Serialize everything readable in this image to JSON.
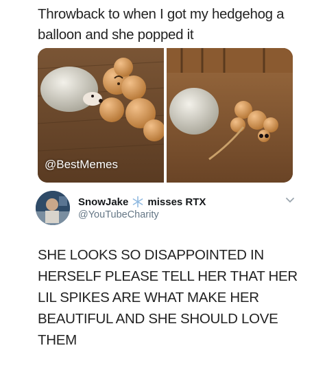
{
  "caption": "Throwback to when I got my hedgehog a balloon and she popped it",
  "media": {
    "watermark": "@BestMemes"
  },
  "reply": {
    "display_name": "SnowJake",
    "name_suffix": "misses RTX",
    "handle": "@YouTubeCharity",
    "text": "SHE LOOKS SO DISAPPOINTED IN HERSELF PLEASE TELL HER THAT HER LIL SPIKES ARE WHAT MAKE HER BEAUTIFUL AND SHE SHOULD LOVE THEM"
  },
  "colors": {
    "wood": "#6b4a2e",
    "balloon": "#c98a4a",
    "handle_gray": "#657786"
  },
  "icons": [
    "snowflake-icon",
    "chevron-down-icon"
  ]
}
